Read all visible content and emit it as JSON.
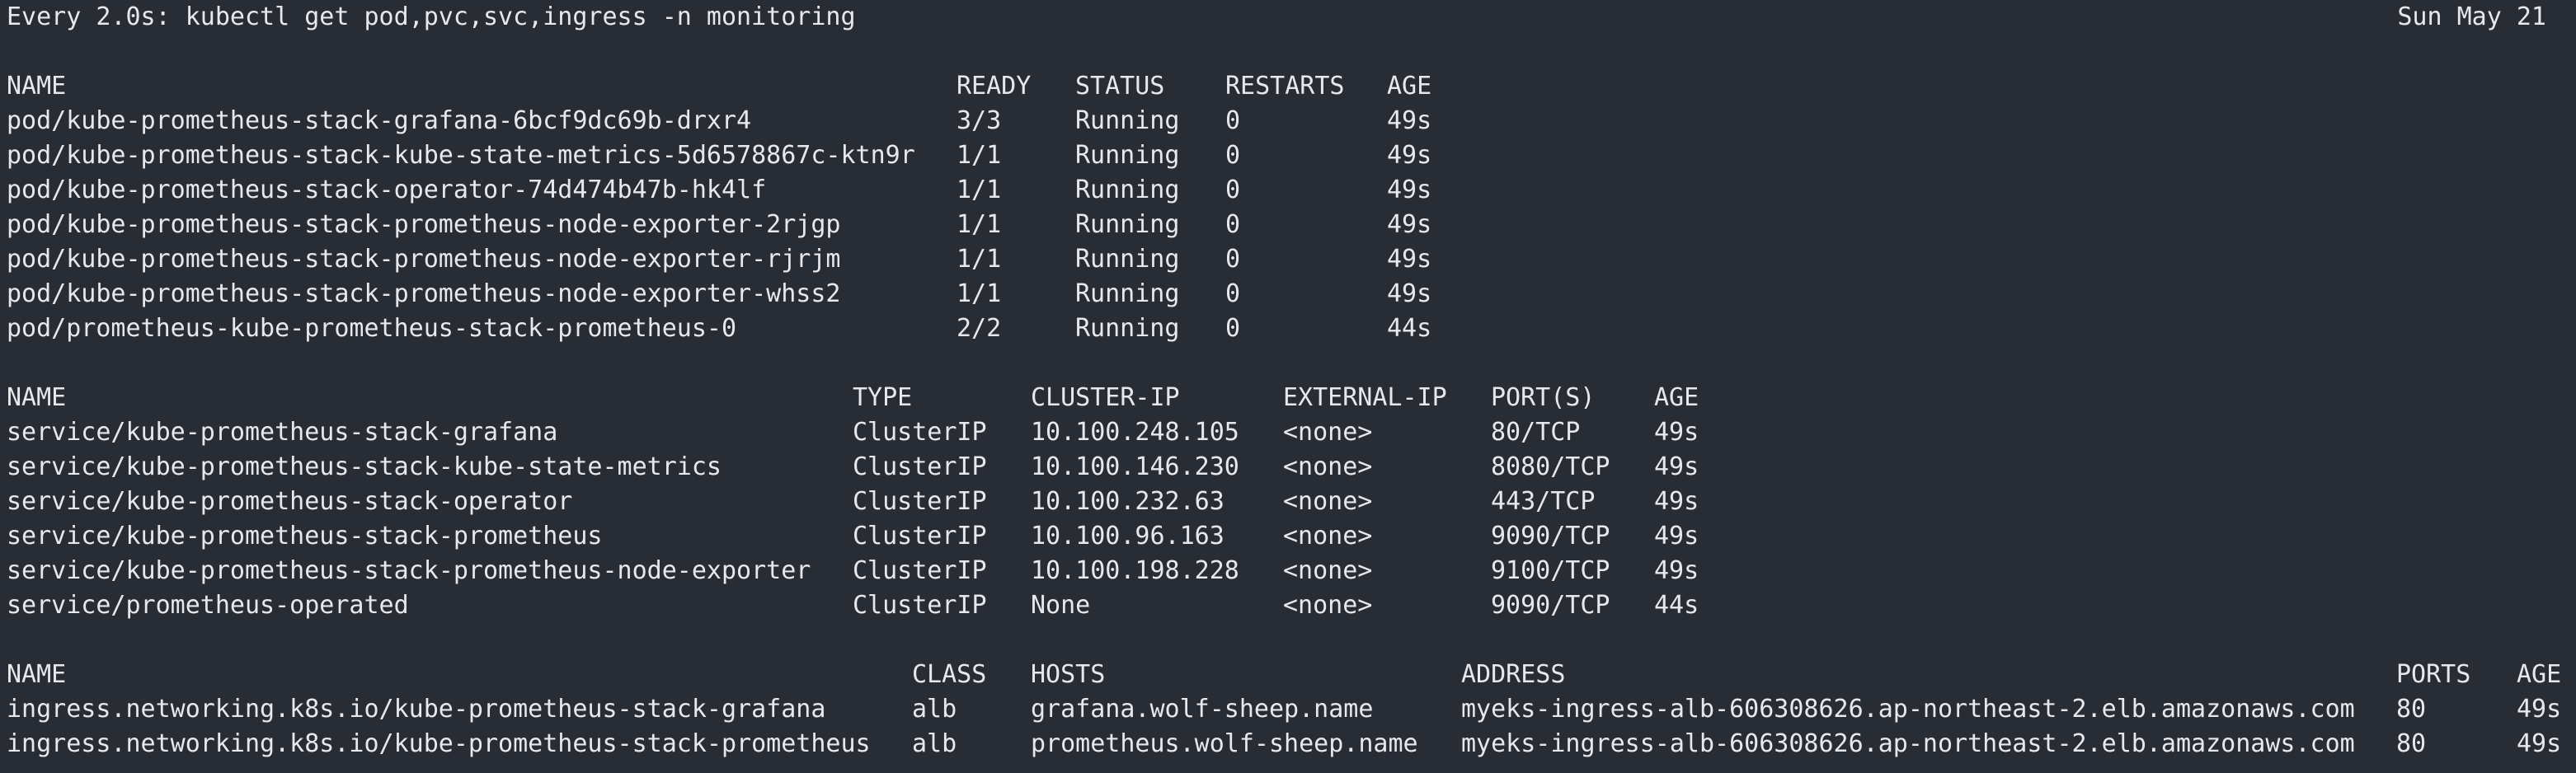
{
  "header": {
    "command": "Every 2.0s: kubectl get pod,pvc,svc,ingress -n monitoring",
    "date": "Sun May 21"
  },
  "pods": {
    "columns": [
      "NAME",
      "READY",
      "STATUS",
      "RESTARTS",
      "AGE"
    ],
    "rows": [
      [
        "pod/kube-prometheus-stack-grafana-6bcf9dc69b-drxr4",
        "3/3",
        "Running",
        "0",
        "49s"
      ],
      [
        "pod/kube-prometheus-stack-kube-state-metrics-5d6578867c-ktn9r",
        "1/1",
        "Running",
        "0",
        "49s"
      ],
      [
        "pod/kube-prometheus-stack-operator-74d474b47b-hk4lf",
        "1/1",
        "Running",
        "0",
        "49s"
      ],
      [
        "pod/kube-prometheus-stack-prometheus-node-exporter-2rjgp",
        "1/1",
        "Running",
        "0",
        "49s"
      ],
      [
        "pod/kube-prometheus-stack-prometheus-node-exporter-rjrjm",
        "1/1",
        "Running",
        "0",
        "49s"
      ],
      [
        "pod/kube-prometheus-stack-prometheus-node-exporter-whss2",
        "1/1",
        "Running",
        "0",
        "49s"
      ],
      [
        "pod/prometheus-kube-prometheus-stack-prometheus-0",
        "2/2",
        "Running",
        "0",
        "44s"
      ]
    ]
  },
  "services": {
    "columns": [
      "NAME",
      "TYPE",
      "CLUSTER-IP",
      "EXTERNAL-IP",
      "PORT(S)",
      "AGE"
    ],
    "rows": [
      [
        "service/kube-prometheus-stack-grafana",
        "ClusterIP",
        "10.100.248.105",
        "<none>",
        "80/TCP",
        "49s"
      ],
      [
        "service/kube-prometheus-stack-kube-state-metrics",
        "ClusterIP",
        "10.100.146.230",
        "<none>",
        "8080/TCP",
        "49s"
      ],
      [
        "service/kube-prometheus-stack-operator",
        "ClusterIP",
        "10.100.232.63",
        "<none>",
        "443/TCP",
        "49s"
      ],
      [
        "service/kube-prometheus-stack-prometheus",
        "ClusterIP",
        "10.100.96.163",
        "<none>",
        "9090/TCP",
        "49s"
      ],
      [
        "service/kube-prometheus-stack-prometheus-node-exporter",
        "ClusterIP",
        "10.100.198.228",
        "<none>",
        "9100/TCP",
        "49s"
      ],
      [
        "service/prometheus-operated",
        "ClusterIP",
        "None",
        "<none>",
        "9090/TCP",
        "44s"
      ]
    ]
  },
  "ingresses": {
    "columns": [
      "NAME",
      "CLASS",
      "HOSTS",
      "ADDRESS",
      "PORTS",
      "AGE"
    ],
    "rows": [
      [
        "ingress.networking.k8s.io/kube-prometheus-stack-grafana",
        "alb",
        "grafana.wolf-sheep.name",
        "myeks-ingress-alb-606308626.ap-northeast-2.elb.amazonaws.com",
        "80",
        "49s"
      ],
      [
        "ingress.networking.k8s.io/kube-prometheus-stack-prometheus",
        "alb",
        "prometheus.wolf-sheep.name",
        "myeks-ingress-alb-606308626.ap-northeast-2.elb.amazonaws.com",
        "80",
        "49s"
      ]
    ]
  }
}
